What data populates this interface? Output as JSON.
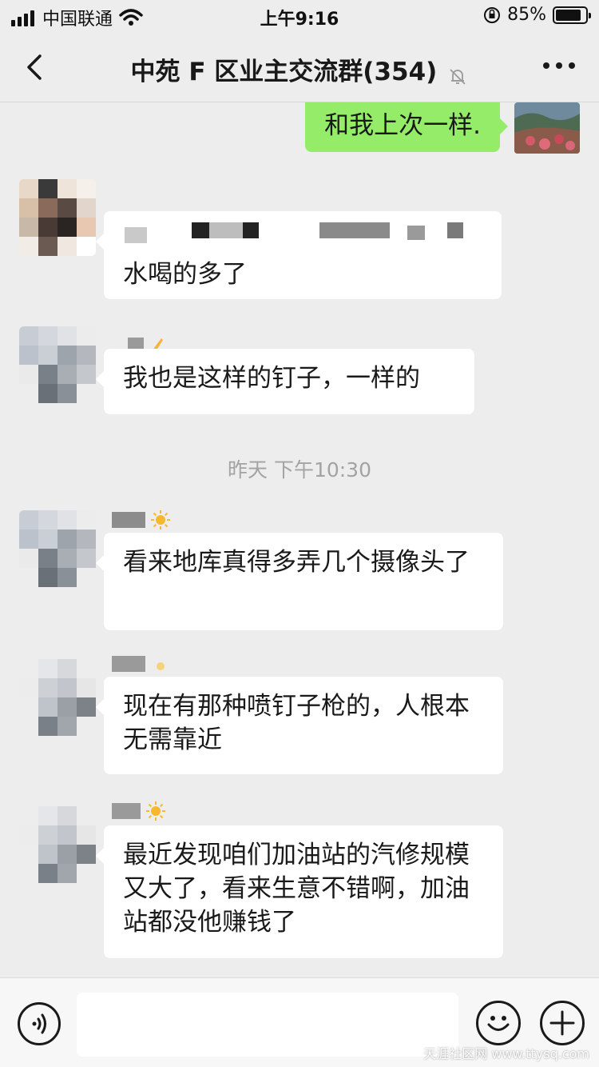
{
  "status_bar": {
    "carrier": "中国联通",
    "time": "上午9:16",
    "battery_text": "85%",
    "battery_level": 0.85
  },
  "header": {
    "title": "中苑 F 区业主交流群(354)"
  },
  "messages": [
    {
      "text": "和我上次一样.",
      "mine": true
    },
    {
      "text": "水喝的多了",
      "mine": false
    },
    {
      "text": "我也是这样的钉子，一样的",
      "mine": false
    },
    {
      "text": "看来地库真得多弄几个摄像头了",
      "mine": false
    },
    {
      "text": "现在有那种喷钉子枪的，人根本无需靠近",
      "mine": false
    },
    {
      "text": "最近发现咱们加油站的汽修规模又大了，看来生意不错啊，加油站都没他赚钱了",
      "mine": false
    }
  ],
  "time_separator": "昨天 下午10:30",
  "input_bar": {
    "placeholder": ""
  },
  "watermark": "天涯社区网 www.ttysq.com",
  "colors": {
    "background": "#ededed",
    "my_bubble": "#95ec69",
    "other_bubble": "#ffffff"
  }
}
